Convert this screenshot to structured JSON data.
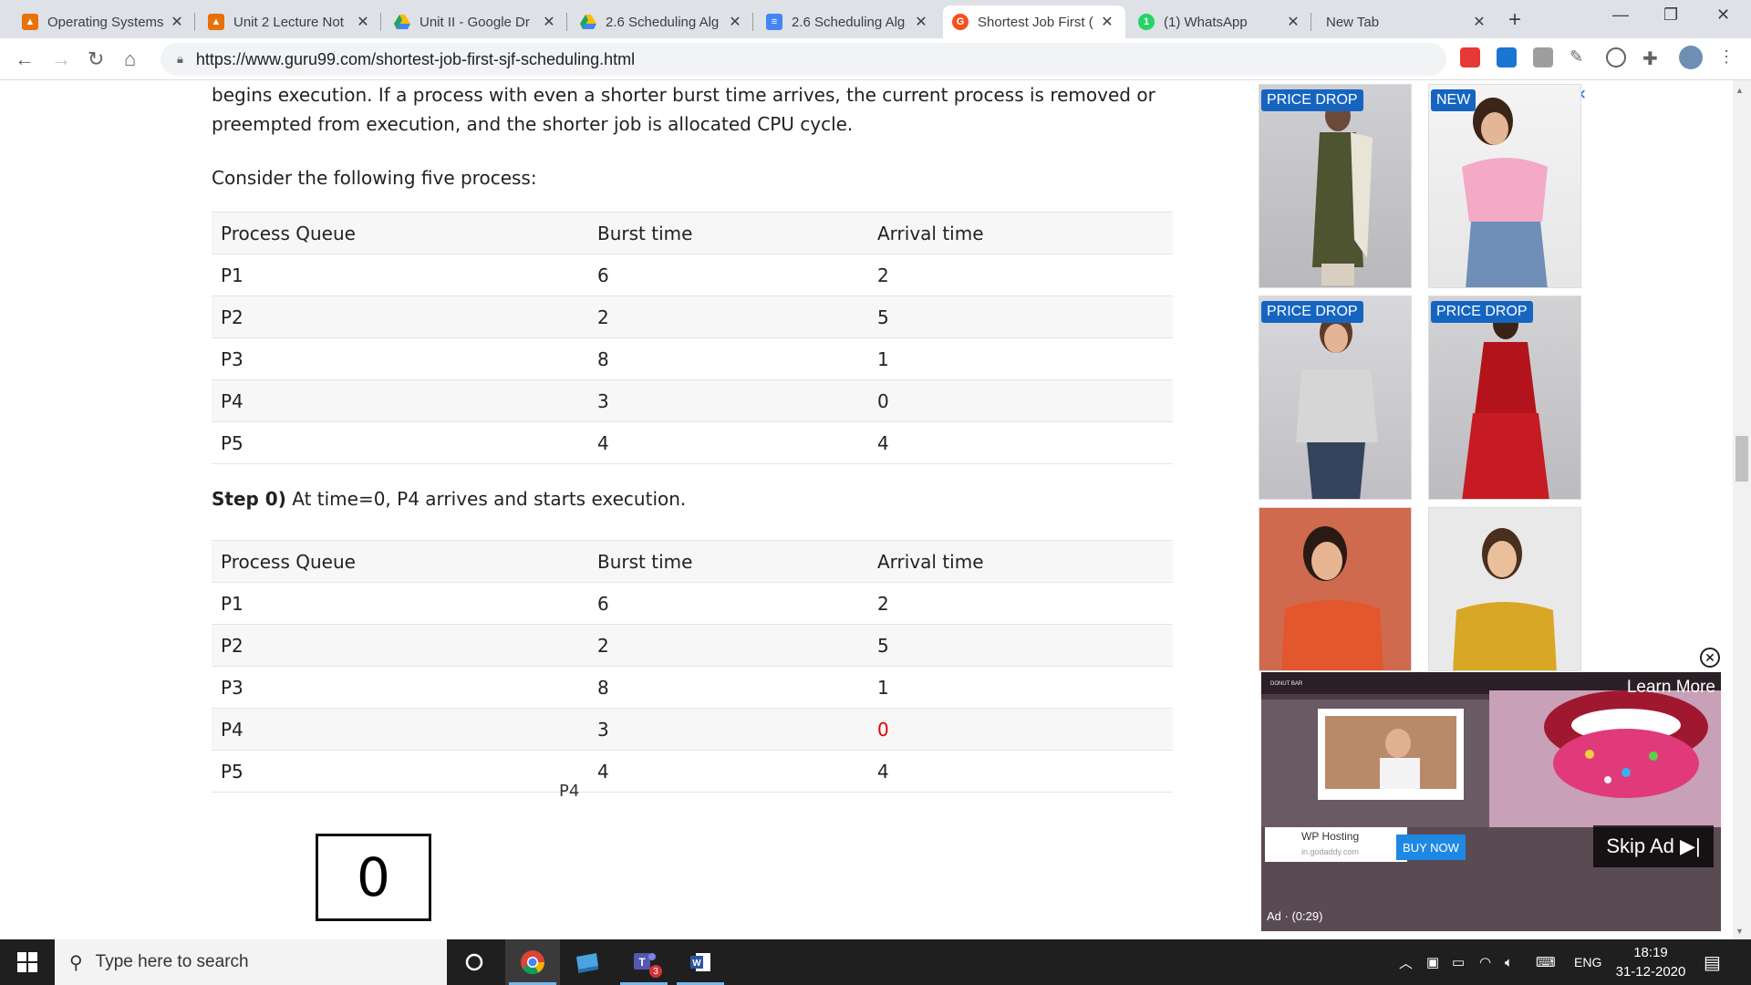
{
  "browser": {
    "tabs": [
      {
        "title": "Operating Systems",
        "favicon_color": "#e8710a"
      },
      {
        "title": "Unit 2 Lecture Not",
        "favicon_color": "#e8710a"
      },
      {
        "title": "Unit II - Google Dr",
        "favicon_color": "#1fa463"
      },
      {
        "title": "2.6 Scheduling Alg",
        "favicon_color": "#1fa463"
      },
      {
        "title": "2.6 Scheduling Alg",
        "favicon_color": "#4285f4"
      },
      {
        "title": "Shortest Job First (",
        "favicon_color": "#f4511e"
      },
      {
        "title": "(1) WhatsApp",
        "favicon_color": "#25d366"
      },
      {
        "title": "New Tab",
        "favicon_color": ""
      }
    ],
    "url": "https://www.guru99.com/shortest-job-first-sjf-scheduling.html"
  },
  "article": {
    "intro_line1": "begins execution. If a process with even a shorter burst time arrives, the current process is removed or",
    "intro_line2": "preempted from execution, and the shorter job is allocated CPU cycle.",
    "consider": "Consider the following five process:",
    "table_headers": [
      "Process Queue",
      "Burst time",
      "Arrival time"
    ],
    "table1": [
      [
        "P1",
        "6",
        "2"
      ],
      [
        "P2",
        "2",
        "5"
      ],
      [
        "P3",
        "8",
        "1"
      ],
      [
        "P4",
        "3",
        "0"
      ],
      [
        "P5",
        "4",
        "4"
      ]
    ],
    "step0_bold": "Step 0)",
    "step0_text": " At time=0, P4 arrives and starts execution.",
    "table2": [
      [
        "P1",
        "6",
        "2"
      ],
      [
        "P2",
        "2",
        "5"
      ],
      [
        "P3",
        "8",
        "1"
      ],
      [
        "P4",
        "3",
        "0"
      ],
      [
        "P5",
        "4",
        "4"
      ]
    ],
    "gantt_time": "0",
    "gantt_process": "P4"
  },
  "ads": {
    "badges": [
      "PRICE DROP",
      "NEW",
      "PRICE DROP",
      "PRICE DROP"
    ],
    "video": {
      "brand": "DONUT BAR",
      "learn_more": "Learn More",
      "hosting_title": "WP Hosting",
      "hosting_domain": "in.godaddy.com",
      "buy_now": "BUY NOW",
      "skip": "Skip Ad ▶|",
      "ad_timer": "Ad · (0:29)"
    }
  },
  "taskbar": {
    "search_placeholder": "Type here to search",
    "lang": "ENG",
    "time": "18:19",
    "date": "31-12-2020",
    "teams_badge": "3"
  }
}
